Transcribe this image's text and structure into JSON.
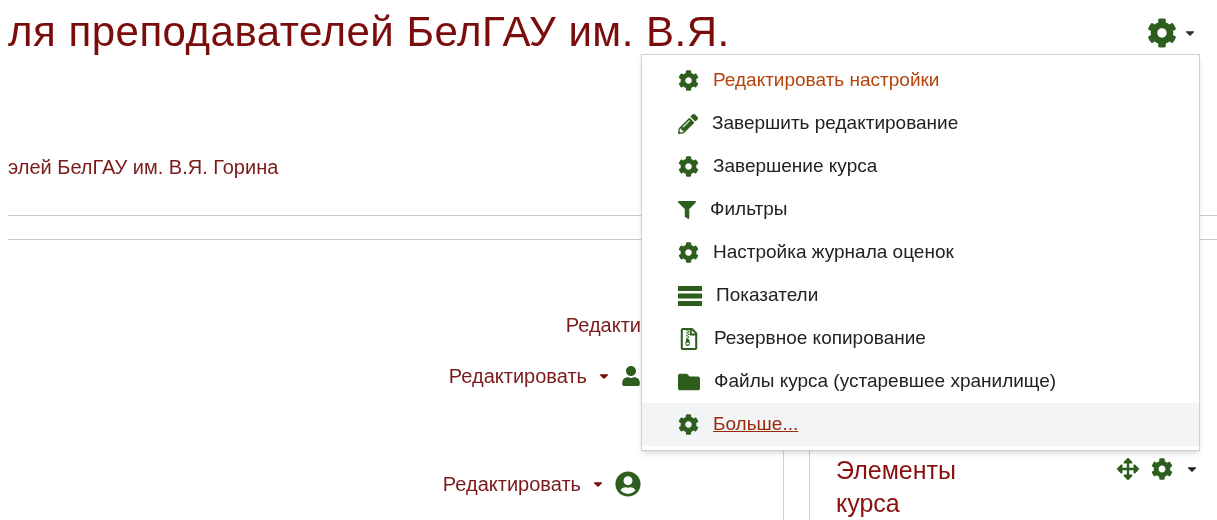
{
  "header": {
    "title": "ля преподавателей БелГАУ им. В.Я.",
    "subtitle": "элей БелГАУ им. В.Я. Горина"
  },
  "edit_links": [
    "Редакти",
    "Редактировать",
    "Редактировать"
  ],
  "block": {
    "title": "Элементы курса"
  },
  "menu": {
    "items": [
      {
        "label": "Редактировать настройки",
        "active": true,
        "highlighted": false,
        "kind": "item"
      },
      {
        "label": "Завершить редактирование",
        "active": false,
        "highlighted": false,
        "kind": "item"
      },
      {
        "label": "Завершение курса",
        "active": false,
        "highlighted": false,
        "kind": "item"
      },
      {
        "label": "Фильтры",
        "active": false,
        "highlighted": false,
        "kind": "item"
      },
      {
        "label": "Настройка журнала оценок",
        "active": false,
        "highlighted": false,
        "kind": "item"
      },
      {
        "label": "Показатели",
        "active": false,
        "highlighted": false,
        "kind": "item"
      },
      {
        "label": "Резервное копирование",
        "active": false,
        "highlighted": false,
        "kind": "item"
      },
      {
        "label": "Файлы курса (устаревшее хранилище)",
        "active": false,
        "highlighted": false,
        "kind": "item"
      },
      {
        "label": "Больше...",
        "active": false,
        "highlighted": true,
        "kind": "link"
      }
    ]
  }
}
